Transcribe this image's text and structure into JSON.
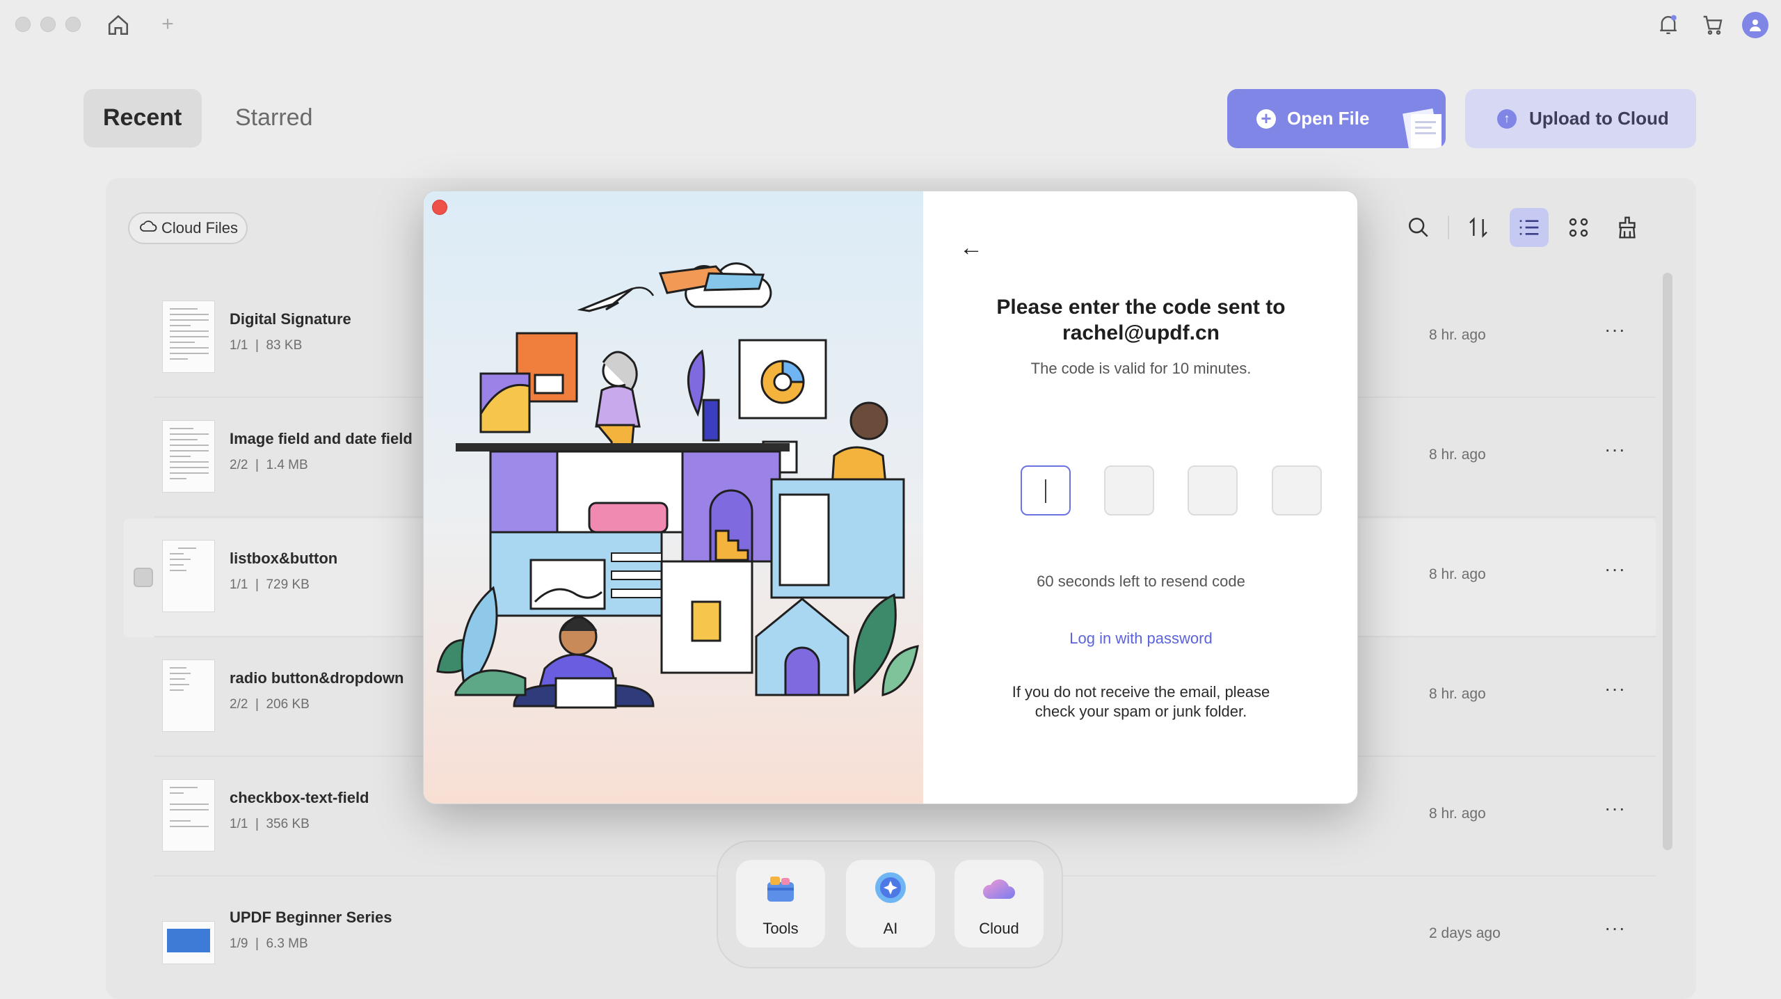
{
  "header": {
    "tabs": [
      {
        "label": "Recent",
        "active": true
      },
      {
        "label": "Starred",
        "active": false
      }
    ],
    "open_file_label": "Open File",
    "upload_label": "Upload to Cloud"
  },
  "toolbar": {
    "cloud_files_label": "Cloud Files",
    "icons": [
      "search-icon",
      "sort-icon",
      "list-view-icon",
      "grid-view-icon",
      "clean-icon"
    ]
  },
  "files": [
    {
      "name": "Digital Signature",
      "pages": "1/1",
      "size": "83 KB",
      "time": "8 hr. ago"
    },
    {
      "name": "Image field and date field",
      "pages": "2/2",
      "size": "1.4 MB",
      "time": "8 hr. ago"
    },
    {
      "name": "listbox&button",
      "pages": "1/1",
      "size": "729 KB",
      "time": "8 hr. ago"
    },
    {
      "name": "radio button&dropdown",
      "pages": "2/2",
      "size": "206 KB",
      "time": "8 hr. ago"
    },
    {
      "name": "checkbox-text-field",
      "pages": "1/1",
      "size": "356 KB",
      "time": "8 hr. ago"
    },
    {
      "name": "UPDF Beginner Series",
      "pages": "1/9",
      "size": "6.3 MB",
      "time": "2 days ago"
    }
  ],
  "more_label": "···",
  "dock": [
    {
      "label": "Tools",
      "icon": "tools-icon"
    },
    {
      "label": "AI",
      "icon": "ai-icon"
    },
    {
      "label": "Cloud",
      "icon": "cloud-icon"
    }
  ],
  "modal": {
    "back_label": "←",
    "heading_line1": "Please enter the code sent to",
    "heading_line2": "rachel@updf.cn",
    "valid_text": "The code is valid for 10 minutes.",
    "resend_text": "60 seconds left to resend code",
    "password_link": "Log in with password",
    "note_line1": "If you do not receive the email, please",
    "note_line2": "check your spam or junk folder."
  },
  "colors": {
    "accent": "#7f86e6",
    "accent_light": "#d7d9f4",
    "link": "#5b63db",
    "close": "#ed5147"
  }
}
